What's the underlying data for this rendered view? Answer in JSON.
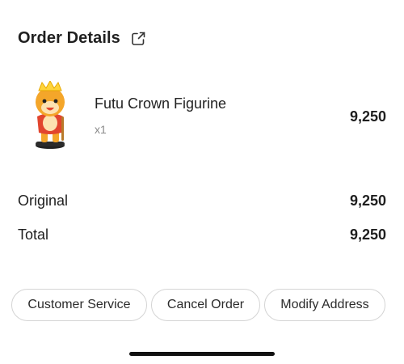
{
  "header": {
    "title": "Order Details",
    "share_icon": "share-export-icon"
  },
  "product": {
    "name": "Futu Crown Figurine",
    "quantity": "x1",
    "price": "9,250",
    "image_icon": "crown-figurine-image"
  },
  "summary": {
    "original_label": "Original",
    "original_value": "9,250",
    "total_label": "Total",
    "total_value": "9,250"
  },
  "actions": {
    "customer_service": "Customer Service",
    "cancel_order": "Cancel Order",
    "modify_address": "Modify Address"
  },
  "colors": {
    "text": "#1f1f1f",
    "muted": "#8a8a8a",
    "border": "#d4d4d4",
    "figurine_orange": "#f4a62a",
    "figurine_red": "#e2452e"
  }
}
